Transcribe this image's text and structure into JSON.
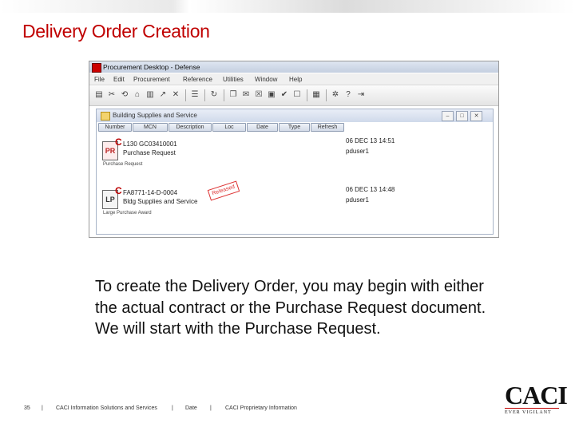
{
  "slide": {
    "title": "Delivery Order Creation",
    "caption": "To create the Delivery Order, you may begin with either the actual contract or the Purchase Request document.  We will start with the Purchase Request."
  },
  "app": {
    "window_title": "Procurement Desktop - Defense",
    "menu": [
      "File",
      "Edit",
      "Procurement",
      "Reference",
      "Utilities",
      "Window",
      "Help"
    ],
    "toolbar_icons": [
      "folder-icon",
      "cut-icon",
      "recycle-icon",
      "trash-icon",
      "document-icon",
      "arrow-icon",
      "scissors-icon",
      "check-icon",
      "open-icon",
      "copy-icon",
      "envelope-icon",
      "approve-icon",
      "check-icon",
      "reject-icon",
      "book-icon",
      "tools-icon",
      "help-icon",
      "exit-icon"
    ]
  },
  "inner_window": {
    "title": "Building Supplies and Service",
    "columns": [
      "Number",
      "MCN",
      "Description",
      "Loc",
      "Date",
      "Type",
      "Refresh"
    ],
    "rows": [
      {
        "number": "L130 GC03410001",
        "description": "Purchase Request",
        "type": "Purchase Request",
        "date": "06 DEC 13  14:51",
        "user": "pduser1",
        "icon": "purchase-request-icon",
        "icon_text": "PR"
      },
      {
        "number": "FA8771-14-D-0004",
        "description": "Bldg Supplies and Service",
        "type": "Large Purchase Award",
        "date": "06 DEC 13  14:48",
        "user": "pduser1",
        "icon": "contract-icon",
        "icon_text": "LP",
        "stamp": "Released"
      }
    ]
  },
  "footer": {
    "page_number": "35",
    "company": "CACI Information Solutions and Services",
    "date": "Date",
    "proprietary": "CACI Proprietary Information",
    "separator": "|"
  },
  "logo": {
    "word": "CACI",
    "tagline": "EVER VIGILANT"
  }
}
